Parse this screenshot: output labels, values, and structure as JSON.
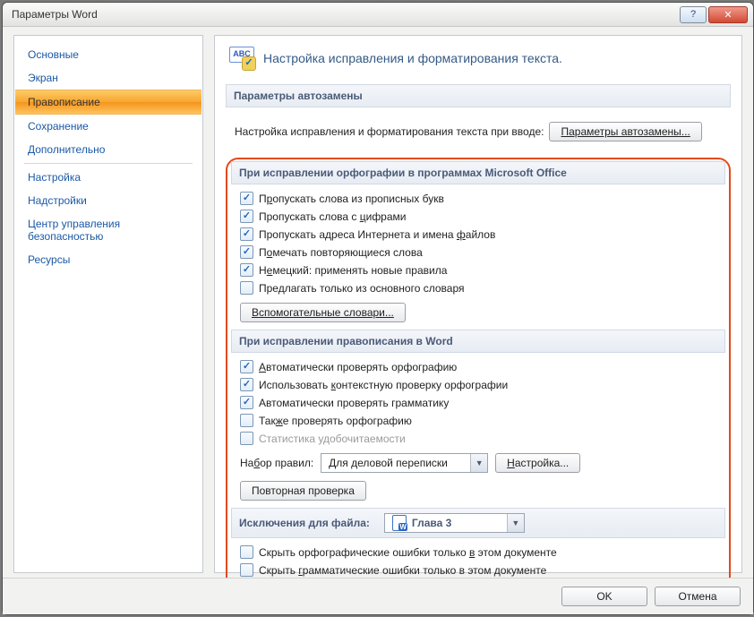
{
  "window": {
    "title": "Параметры Word"
  },
  "sidebar": {
    "items": [
      {
        "label": "Основные"
      },
      {
        "label": "Экран"
      },
      {
        "label": "Правописание",
        "selected": true
      },
      {
        "label": "Сохранение"
      },
      {
        "label": "Дополнительно"
      },
      {
        "label": "Настройка"
      },
      {
        "label": "Надстройки"
      },
      {
        "label": "Центр управления безопасностью"
      },
      {
        "label": "Ресурсы"
      }
    ]
  },
  "heading": "Настройка исправления и форматирования текста.",
  "autocorr": {
    "header": "Параметры автозамены",
    "text": "Настройка исправления и форматирования текста при вводе:",
    "button": "Параметры автозамены..."
  },
  "office": {
    "header": "При исправлении орфографии в программах Microsoft Office",
    "opts": [
      {
        "label": "Пропускать слова из прописных букв",
        "checked": true,
        "u": "р"
      },
      {
        "label": "Пропускать слова с цифрами",
        "checked": true,
        "u": "ц"
      },
      {
        "label": "Пропускать адреса Интернета и имена файлов",
        "checked": true,
        "u": "ф"
      },
      {
        "label": "Помечать повторяющиеся слова",
        "checked": true,
        "u": "о"
      },
      {
        "label": "Немецкий: применять новые правила",
        "checked": true,
        "u": "е"
      },
      {
        "label": "Предлагать только из основного словаря",
        "checked": false
      }
    ],
    "dict_btn": "Вспомогательные словари..."
  },
  "word": {
    "header": "При исправлении правописания в Word",
    "opts": [
      {
        "label": "Автоматически проверять орфографию",
        "checked": true,
        "u": "А"
      },
      {
        "label": "Использовать контекстную проверку орфографии",
        "checked": true,
        "u": "к"
      },
      {
        "label": "Автоматически проверять грамматику",
        "checked": true
      },
      {
        "label": "Также проверять орфографию",
        "checked": false,
        "u": "ж"
      },
      {
        "label": "Статистика удобочитаемости",
        "checked": false,
        "disabled": true
      }
    ],
    "ruleset_label": "Набор правил:",
    "ruleset_value": "Для деловой переписки",
    "settings_btn": "Настройка...",
    "recheck_btn": "Повторная проверка"
  },
  "exceptions": {
    "header": "Исключения для файла:",
    "file": "Глава 3",
    "opts": [
      {
        "label": "Скрыть орфографические ошибки только в этом документе",
        "checked": false,
        "u": "в"
      },
      {
        "label": "Скрыть грамматические ошибки только в этом документе",
        "checked": false,
        "u": "г"
      }
    ]
  },
  "footer": {
    "ok": "OK",
    "cancel": "Отмена"
  }
}
